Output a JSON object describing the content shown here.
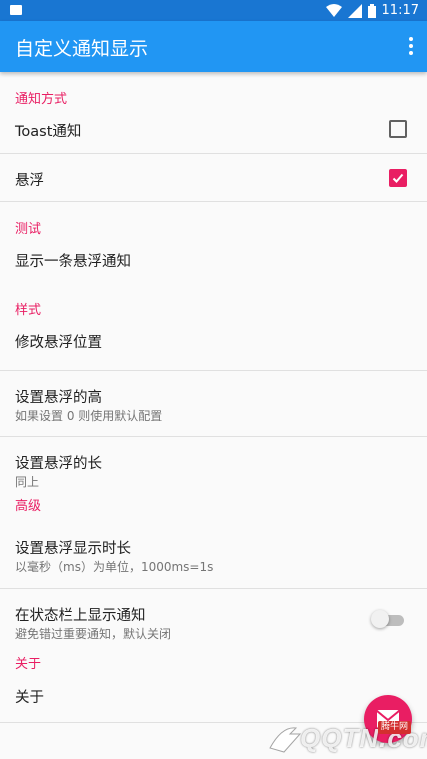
{
  "status_bar": {
    "time": "11:17"
  },
  "app_bar": {
    "title": "自定义通知显示"
  },
  "sections": {
    "notify_method": {
      "header": "通知方式",
      "toast": {
        "title": "Toast通知",
        "checked": false
      },
      "float": {
        "title": "悬浮",
        "checked": true
      }
    },
    "test": {
      "header": "测试",
      "show_float": {
        "title": "显示一条悬浮通知"
      }
    },
    "style": {
      "header": "样式",
      "position": {
        "title": "修改悬浮位置"
      },
      "height": {
        "title": "设置悬浮的高",
        "summary": "如果设置 0 则使用默认配置"
      },
      "width": {
        "title": "设置悬浮的长",
        "summary": "同上"
      }
    },
    "advanced": {
      "header": "高级",
      "duration": {
        "title": "设置悬浮显示时长",
        "summary": "以毫秒（ms）为单位，1000ms=1s"
      },
      "statusbar": {
        "title": "在状态栏上显示通知",
        "summary": "避免错过重要通知，默认关闭",
        "enabled": false
      }
    },
    "about": {
      "header": "关于",
      "about": {
        "title": "关于"
      }
    }
  },
  "fab": {
    "icon": "mail-icon"
  },
  "watermark": {
    "badge": "腾牛网",
    "logo_text": "QQTN.com"
  },
  "colors": {
    "primary": "#2196f3",
    "primary_dark": "#1976d2",
    "accent": "#e91e63"
  }
}
